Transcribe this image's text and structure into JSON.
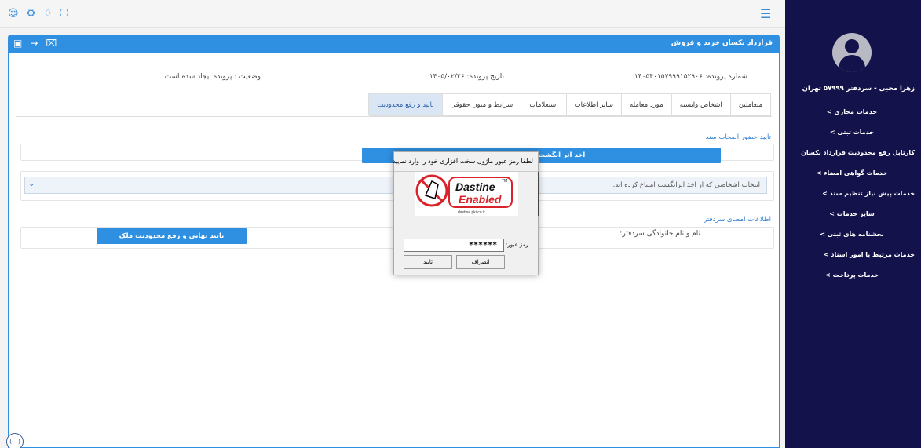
{
  "topbar": {
    "icons": [
      "user-circle-icon",
      "gear-icon",
      "bell-icon",
      "fullscreen-icon"
    ],
    "menu_icon": "hamburger-icon"
  },
  "sidebar": {
    "user": "زهرا محبی - سردفتر ۵۷۹۹۹ تهران",
    "items": [
      {
        "label": "خدمات مجازی  >",
        "centered": true
      },
      {
        "label": "خدمات ثبتی  >",
        "centered": true
      },
      {
        "label": "کارتابل رفع محدودیت قرارداد یکسان",
        "centered": false
      },
      {
        "label": "خدمات گواهی امضاء  >",
        "centered": true
      },
      {
        "label": "خدمات پیش نیاز تنظیم سند  >",
        "centered": false
      },
      {
        "label": "سایر خدمات  >",
        "centered": true
      },
      {
        "label": "بخشنامه های ثبتی  >",
        "centered": true
      },
      {
        "label": "خدمات مرتبط با امور اسناد  >",
        "centered": false
      },
      {
        "label": "خدمات پرداخت  >",
        "centered": true
      }
    ]
  },
  "panel": {
    "title": "قرارداد یکسان خرید و فروش",
    "header_icons": [
      "save-icon",
      "arrow-right-icon",
      "close-box-icon"
    ],
    "file_number": "شماره پرونده: ۱۴۰۵۴۰۱۵۷۹۹۹۱۵۲۹۰۶",
    "file_date": "تاریخ پرونده: ۱۴۰۵/۰۲/۲۶",
    "status": "وضعیت : پرونده ایجاد شده است"
  },
  "tabs": [
    {
      "label": "متعاملین",
      "active": false
    },
    {
      "label": "اشخاص وابسته",
      "active": false
    },
    {
      "label": "مورد معامله",
      "active": false
    },
    {
      "label": "سایر اطلاعات",
      "active": false
    },
    {
      "label": "استعلامات",
      "active": false
    },
    {
      "label": "شرایط و متون حقوقی",
      "active": false
    },
    {
      "label": "تایید و رفع محدودیت",
      "active": true
    }
  ],
  "presence": {
    "label": "تایید حضور اصحاب سند",
    "fingerprint_button": "اخذ اثر انگشت اصحاب سند",
    "select_text": "انتخاب اشخاصی که از اخذ اثرانگشت امتناع کرده اند."
  },
  "notary": {
    "label": "اطلاعات امضای سردفتر",
    "name_label": "نام و نام خانوادگی سردفتر:",
    "final_button": "تایید نهایی و رفع محدودیت ملک"
  },
  "help_text": "(...)",
  "dialog": {
    "title": "لطفا رمز عبور ماژول سخت افزاری خود را وارد نمایید",
    "brand_top": "Dastine",
    "brand_tm": "TM",
    "brand_bottom": "Enabled",
    "brand_url": "dastine.pki.co.ir",
    "password_label": "رمز عبور:",
    "password_value": "******",
    "cancel_button": "انصراف",
    "ok_button": "تایید"
  },
  "colors": {
    "primary": "#2f8fe0",
    "sidebar": "#13124a",
    "brand_red": "#d9232a"
  }
}
